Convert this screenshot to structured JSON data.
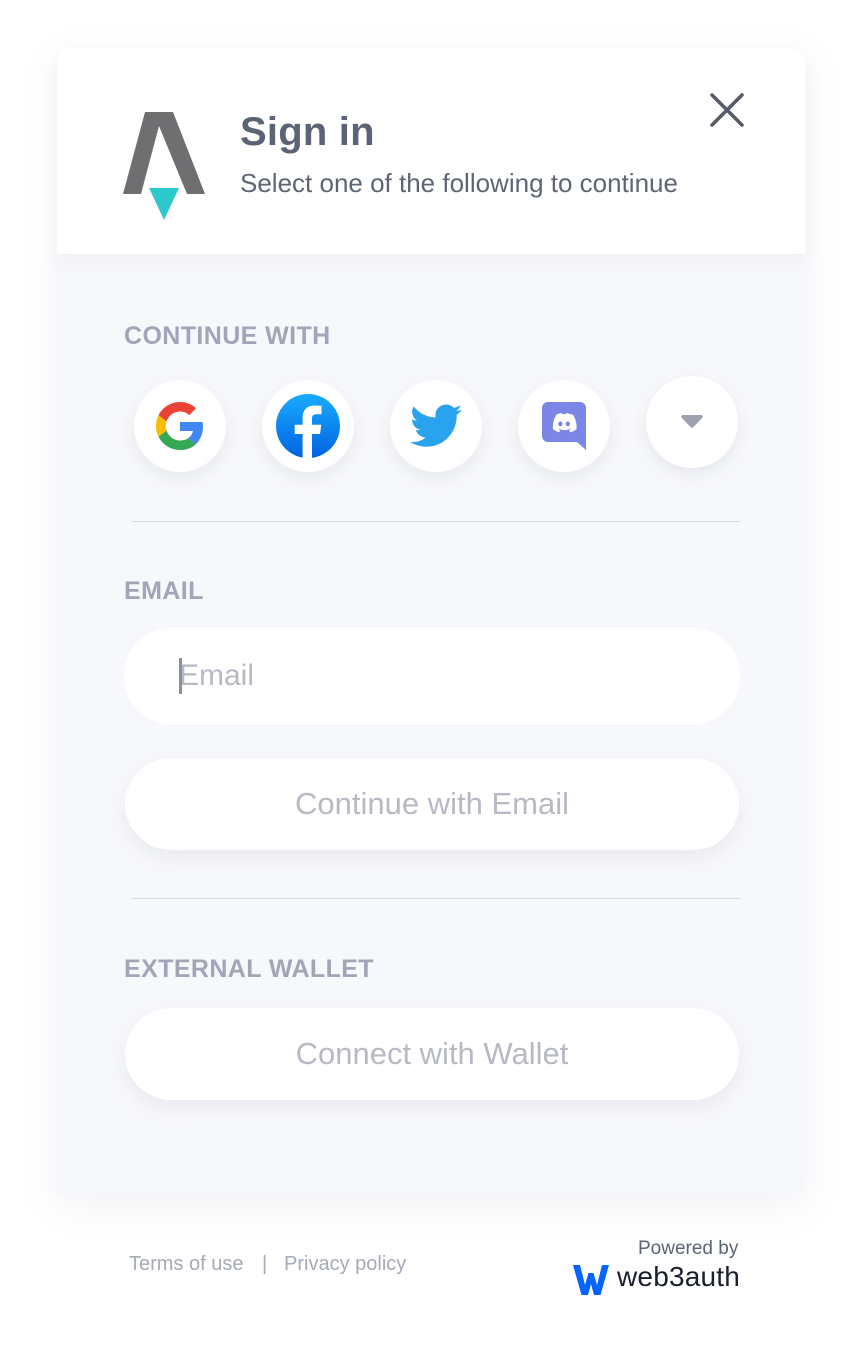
{
  "header": {
    "title": "Sign in",
    "subtitle": "Select one of the following to continue"
  },
  "sections": {
    "social_label": "CONTINUE WITH",
    "email_label": "EMAIL",
    "wallet_label": "EXTERNAL WALLET"
  },
  "social_icons": [
    "google-icon",
    "facebook-icon",
    "twitter-icon",
    "discord-icon",
    "chevron-down-icon"
  ],
  "email": {
    "placeholder": "Email",
    "value": "",
    "button_label": "Continue with Email"
  },
  "wallet": {
    "button_label": "Connect with Wallet"
  },
  "footer": {
    "terms": "Terms of use",
    "separator": "|",
    "privacy": "Privacy policy",
    "powered_by": "Powered by",
    "brand": "web3auth"
  },
  "colors": {
    "brand_teal": "#2ec9cc",
    "logo_gray": "#6f6f72",
    "facebook_blue": "#1877f2",
    "twitter_blue": "#1d9bf0",
    "discord_purple": "#7b86e6",
    "web3auth_blue": "#0364ff"
  }
}
